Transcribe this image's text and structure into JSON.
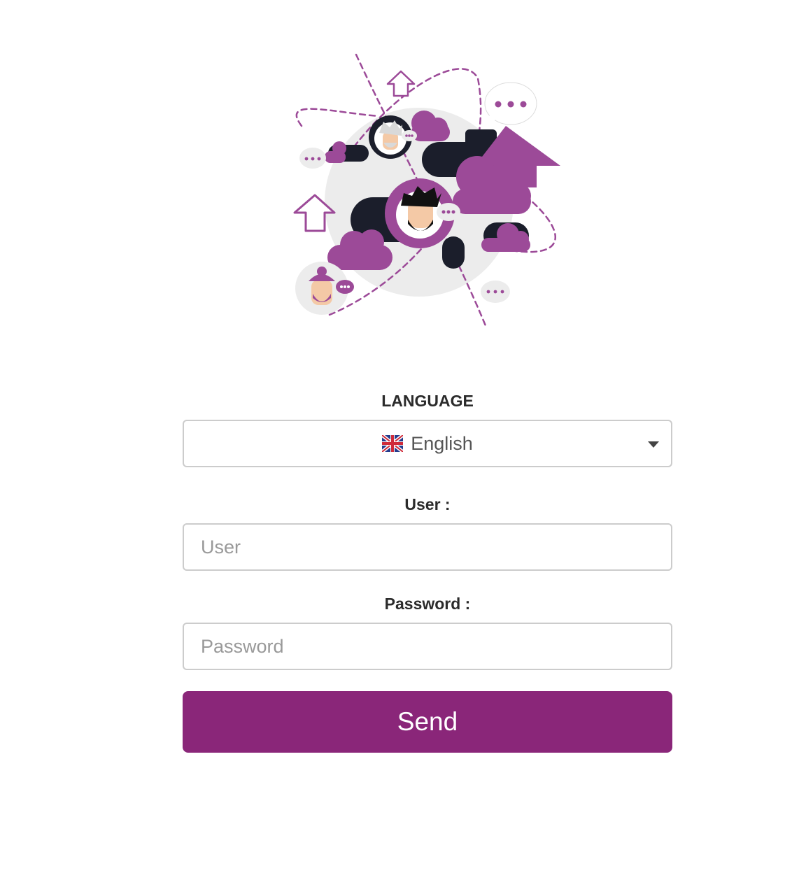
{
  "illustration": {
    "name": "social-network-illustration",
    "icons": [
      "cloud-icon",
      "upload-arrow-icon",
      "chat-bubble-icon",
      "avatar-icon"
    ],
    "colors": {
      "purple": "#9c4a98",
      "dark": "#1b1e2b",
      "globe": "#ececec",
      "skin": "#f4c9a6"
    }
  },
  "form": {
    "language_label": "LANGUAGE",
    "language_select": {
      "value": "English",
      "flag_icon": "uk-flag-icon",
      "caret_icon": "chevron-down-icon"
    },
    "user_label": "User :",
    "user_placeholder": "User",
    "password_label": "Password :",
    "password_placeholder": "Password",
    "send_label": "Send"
  },
  "colors": {
    "accent": "#8a2679",
    "border": "#cccccc",
    "label": "#2b2b2b"
  }
}
